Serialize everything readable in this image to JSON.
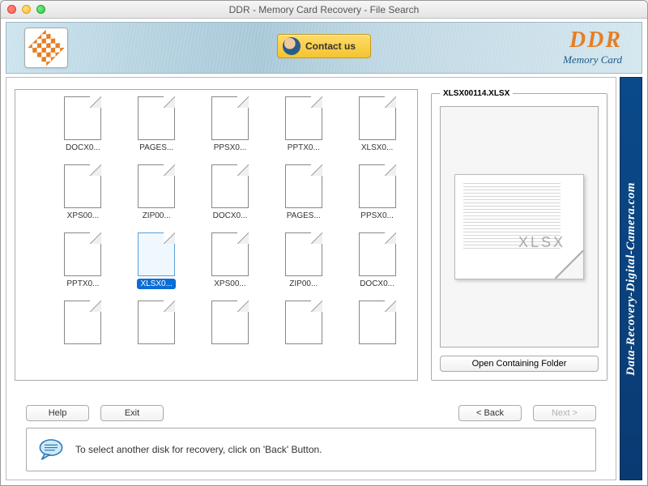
{
  "window": {
    "title": "DDR - Memory Card Recovery - File Search"
  },
  "header": {
    "contact_label": "Contact us",
    "brand_main": "DDR",
    "brand_sub": "Memory Card"
  },
  "files": {
    "items": [
      {
        "label": "DOCX0..."
      },
      {
        "label": "PAGES..."
      },
      {
        "label": "PPSX0..."
      },
      {
        "label": "PPTX0..."
      },
      {
        "label": "XLSX0..."
      },
      {
        "label": "XPS00..."
      },
      {
        "label": "ZIP00..."
      },
      {
        "label": "DOCX0..."
      },
      {
        "label": "PAGES..."
      },
      {
        "label": "PPSX0..."
      },
      {
        "label": "PPTX0..."
      },
      {
        "label": "XLSX0...",
        "selected": true
      },
      {
        "label": "XPS00..."
      },
      {
        "label": "ZIP00..."
      },
      {
        "label": "DOCX0..."
      },
      {
        "label": ""
      },
      {
        "label": ""
      },
      {
        "label": ""
      },
      {
        "label": ""
      },
      {
        "label": ""
      }
    ]
  },
  "preview": {
    "filename": "XLSX00114.XLSX",
    "ext": "XLSX",
    "open_folder_label": "Open Containing Folder"
  },
  "buttons": {
    "help": "Help",
    "exit": "Exit",
    "back": "< Back",
    "next": "Next >"
  },
  "hint": {
    "text": "To select another disk for recovery, click on 'Back' Button."
  },
  "side_banner": {
    "text": "Data-Recovery-Digital-Camera.com"
  }
}
